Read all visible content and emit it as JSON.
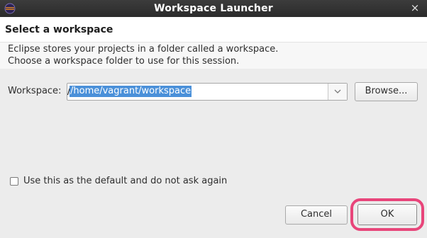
{
  "window": {
    "title": "Workspace Launcher",
    "close_glyph": "×",
    "app_icon": "eclipse-icon"
  },
  "header": {
    "heading": "Select a workspace",
    "description_line1": "Eclipse stores your projects in a folder called a workspace.",
    "description_line2": "Choose a workspace folder to use for this session."
  },
  "workspace": {
    "label": "Workspace:",
    "value": "/home/vagrant/workspace",
    "dropdown_icon": "chevron-down-icon",
    "browse_label": "Browse..."
  },
  "default_option": {
    "checked": false,
    "label": "Use this as the default and do not ask again"
  },
  "buttons": {
    "cancel_label": "Cancel",
    "ok_label": "OK"
  },
  "colors": {
    "titlebar": "#2b2b2b",
    "selection": "#4a90d9",
    "highlight": "#e8457a"
  }
}
